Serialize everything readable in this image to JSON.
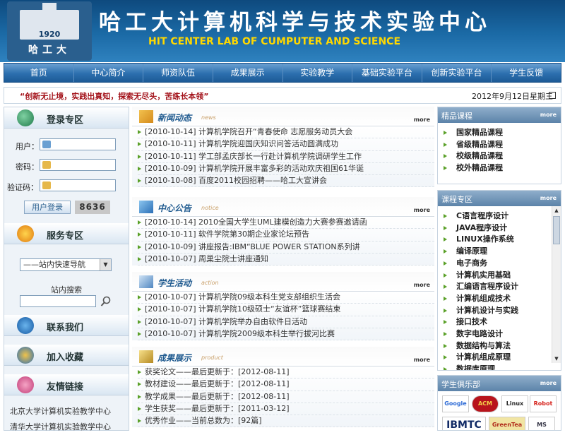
{
  "header": {
    "logo_year": "1920",
    "logo_name": "哈工大",
    "title": "哈工大计算机科学与技术实验中心",
    "subtitle": "HIT CENTER LAB OF CUMPUTER AND SCIENCE"
  },
  "nav": [
    "首页",
    "中心简介",
    "师资队伍",
    "成果展示",
    "实验教学",
    "基础实验平台",
    "创新实验平台",
    "学生反馈"
  ],
  "slogan": "“创新无止境，实践出真知，探索无尽头，苦练长本领”",
  "date": "2012年9月12日星期三",
  "login": {
    "title": "登录专区",
    "user_label": "用户：",
    "password_label": "密码：",
    "captcha_label": "验证码：",
    "button": "用户登录",
    "captcha_code": "8636"
  },
  "service": {
    "title": "服务专区",
    "quick_nav": "——站内快速导航",
    "search_label": "站内搜索"
  },
  "contact": {
    "title": "联系我们"
  },
  "favorite": {
    "title": "加入收藏"
  },
  "links": {
    "title": "友情链接",
    "items": [
      "北京大学计算机实验教学中心",
      "清华大学计算机实验教学中心"
    ]
  },
  "news": {
    "title": "新闻动态",
    "en": "news",
    "more": "more",
    "items": [
      "[2010-10-14] 计算机学院召开“青春使命 志愿服务动员大会",
      "[2010-10-11] 计算机学院迎国庆知识问答活动圆满成功",
      "[2010-10-11] 学工部孟庆部长一行赴计算机学院调研学生工作",
      "[2010-10-09] 计算机学院开展丰富多彩的活动欢庆祖国61华诞",
      "[2010-10-08] 百度2011校园招聘——哈工大宣讲会"
    ]
  },
  "notice": {
    "title": "中心公告",
    "en": "notice",
    "more": "more",
    "items": [
      "[2010-10-14] 2010全国大学生UML建模创造力大赛参赛邀请函",
      "[2010-10-11] 软件学院第30期企业家论坛预告",
      "[2010-10-09] 讲座报告:IBM“BLUE POWER STATION系列讲",
      "[2010-10-07] 周巢尘院士讲座通知"
    ]
  },
  "activity": {
    "title": "学生活动",
    "en": "action",
    "more": "more",
    "items": [
      "[2010-10-07] 计算机学院09级本科生党支部组织生活会",
      "[2010-10-07] 计算机学院10级硕士“友谊杯”篮球赛结束",
      "[2010-10-07] 计算机学院举办自由软件日活动",
      "[2010-10-07] 计算机学院2009级本科生举行拔河比赛"
    ]
  },
  "results": {
    "title": "成果展示",
    "en": "product",
    "more": "more",
    "items": [
      "获奖论文——最后更新于：[2012-08-11]",
      "教材建设——最后更新于：[2012-08-11]",
      "教学成果——最后更新于：[2012-08-11]",
      "学生获奖——最后更新于：[2011-03-12]",
      "优秀作业——当前总数为：[92篇]"
    ]
  },
  "quality_courses": {
    "title": "精品课程",
    "more": "more",
    "items": [
      "国家精品课程",
      "省级精品课程",
      "校级精品课程",
      "校外精品课程"
    ]
  },
  "courses": {
    "title": "课程专区",
    "more": "more",
    "items": [
      "C语言程序设计",
      "JAVA程序设计",
      "LINUX操作系统",
      "编译原理",
      "电子商务",
      "计算机实用基础",
      "汇编语言程序设计",
      "计算机组成技术",
      "计算机设计与实践",
      "接口技术",
      "数字电路设计",
      "数据结构与算法",
      "计算机组成原理",
      "数据库原理"
    ]
  },
  "clubs": {
    "title": "学生俱乐部",
    "more": "more",
    "logos": [
      "Google",
      "ACM",
      "Linux",
      "Robot",
      "IBMTC",
      "GreenTea",
      "MS"
    ]
  }
}
